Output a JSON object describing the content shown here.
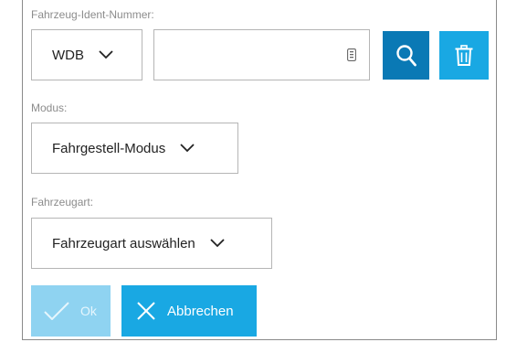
{
  "vin": {
    "label": "Fahrzeug-Ident-Nummer:",
    "prefix_value": "WDB",
    "input_value": "",
    "input_placeholder": ""
  },
  "modus": {
    "label": "Modus:",
    "value": "Fahrgestell-Modus"
  },
  "fahrzeugart": {
    "label": "Fahrzeugart:",
    "value": "Fahrzeugart auswählen"
  },
  "actions": {
    "ok_label": "Ok",
    "cancel_label": "Abbrechen"
  },
  "icons": {
    "search": "search-icon",
    "delete": "trash-icon",
    "ok": "check-icon",
    "cancel": "close-icon",
    "chevron": "chevron-down-icon",
    "keyboard": "keyboard-icon"
  },
  "colors": {
    "primary_dark": "#0a79b5",
    "primary": "#19a8e3",
    "disabled": "#8fd3f1",
    "label": "#8c8c8c",
    "border": "#b5b5b5"
  }
}
